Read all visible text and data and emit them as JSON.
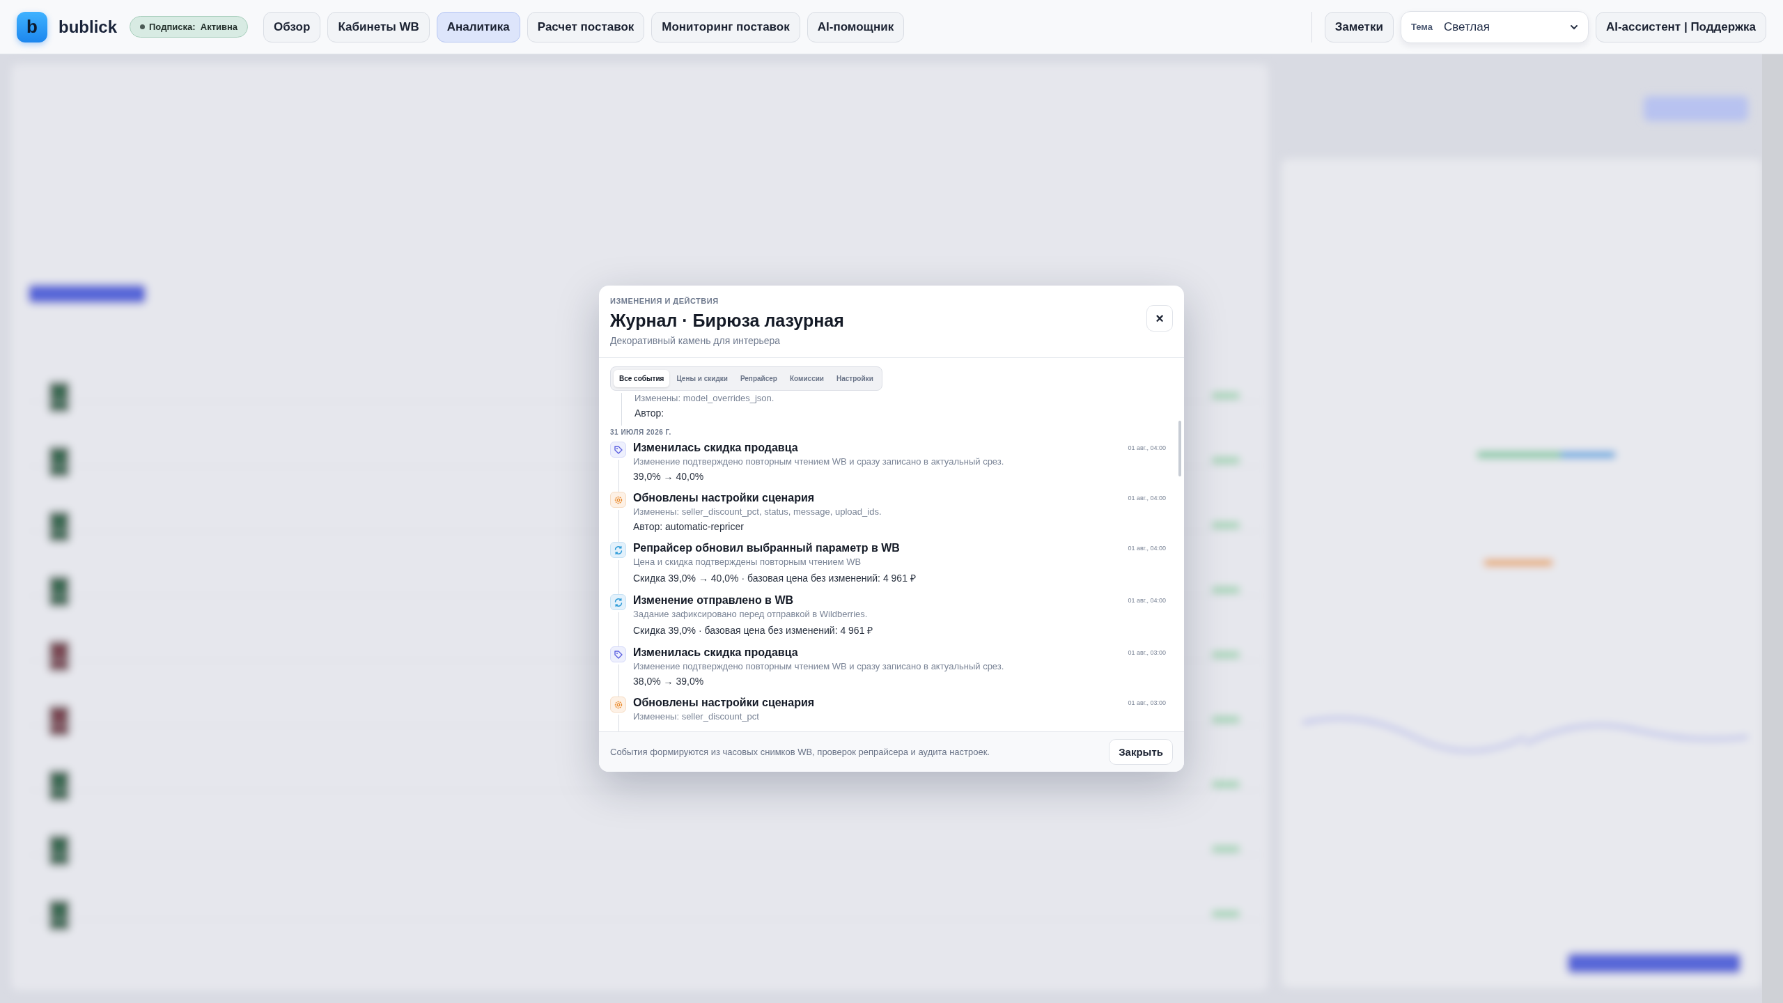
{
  "header": {
    "logo_letter": "b",
    "brand": "bublick",
    "subscription": {
      "label": "Подписка:",
      "value": "Активна",
      "active": true
    },
    "nav": [
      {
        "label": "Обзор",
        "selected": false
      },
      {
        "label": "Кабинеты WB",
        "selected": false
      },
      {
        "label": "Аналитика",
        "selected": true
      },
      {
        "label": "Расчет поставок",
        "selected": false
      },
      {
        "label": "Мониторинг поставок",
        "selected": false
      },
      {
        "label": "AI-помощник",
        "selected": false
      }
    ],
    "notes_button": "Заметки",
    "theme": {
      "label": "Тема",
      "value": "Светлая"
    },
    "support_button": "AI-ассистент | Поддержка"
  },
  "dialog": {
    "eyebrow": "ИЗМЕНЕНИЯ И ДЕЙСТВИЯ",
    "title": "Журнал · Бирюза лазурная",
    "subtitle": "Декоративный камень для интерьера",
    "close_icon": "×",
    "tabs": [
      {
        "label": "Все события",
        "selected": true
      },
      {
        "label": "Цены и скидки",
        "selected": false
      },
      {
        "label": "Репрайсер",
        "selected": false
      },
      {
        "label": "Комиссии",
        "selected": false
      },
      {
        "label": "Настройки",
        "selected": false
      }
    ],
    "previous_event_tail": {
      "description": "Изменены: model_overrides_json.",
      "detail": "Автор:"
    },
    "date_group": "31 ИЮЛЯ 2026 Г.",
    "events": [
      {
        "kind": "discount",
        "title": "Изменилась скидка продавца",
        "description": "Изменение подтверждено повторным чтением WB и сразу записано в актуальный срез.",
        "detail": "39,0% → 40,0%",
        "time": "01 авг., 04:00"
      },
      {
        "kind": "settings",
        "title": "Обновлены настройки сценария",
        "description": "Изменены: seller_discount_pct, status, message, upload_ids.",
        "detail": "Автор: automatic-repricer",
        "time": "01 авг., 04:00"
      },
      {
        "kind": "sync",
        "title": "Репрайсер обновил выбранный параметр в WB",
        "description": "Цена и скидка подтверждены повторным чтением WB",
        "detail": "Скидка 39,0% → 40,0% · базовая цена без изменений: 4 961 ₽",
        "time": "01 авг., 04:00"
      },
      {
        "kind": "sync",
        "title": "Изменение отправлено в WB",
        "description": "Задание зафиксировано перед отправкой в Wildberries.",
        "detail": "Скидка 39,0% · базовая цена без изменений: 4 961 ₽",
        "time": "01 авг., 04:00"
      },
      {
        "kind": "discount",
        "title": "Изменилась скидка продавца",
        "description": "Изменение подтверждено повторным чтением WB и сразу записано в актуальный срез.",
        "detail": "38,0% → 39,0%",
        "time": "01 авг., 03:00"
      },
      {
        "kind": "settings",
        "title": "Обновлены настройки сценария",
        "description": "Изменены: seller_discount_pct",
        "time": "01 авг., 03:00"
      }
    ],
    "footer_note": "События формируются из часовых снимков WB, проверок репрайсера и аудита настроек.",
    "close_button": "Закрыть"
  }
}
